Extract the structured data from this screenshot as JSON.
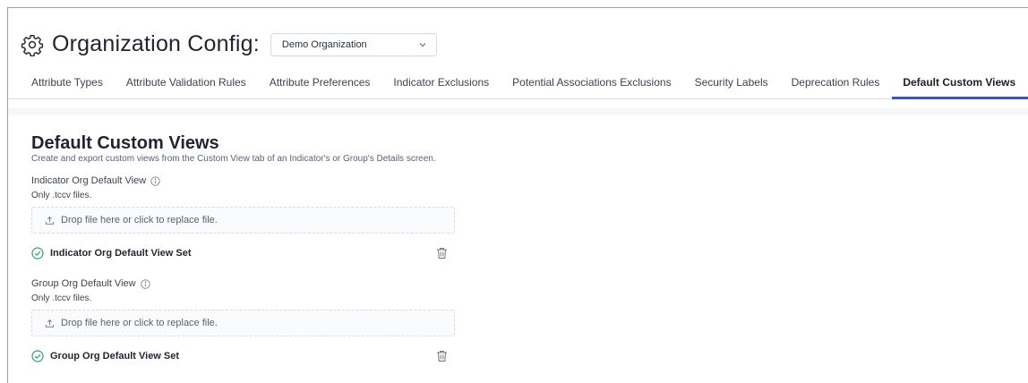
{
  "header": {
    "title": "Organization Config:",
    "org_select": {
      "value": "Demo Organization"
    }
  },
  "tabs": [
    {
      "label": "Attribute Types",
      "active": false
    },
    {
      "label": "Attribute Validation Rules",
      "active": false
    },
    {
      "label": "Attribute Preferences",
      "active": false
    },
    {
      "label": "Indicator Exclusions",
      "active": false
    },
    {
      "label": "Potential Associations Exclusions",
      "active": false
    },
    {
      "label": "Security Labels",
      "active": false
    },
    {
      "label": "Deprecation Rules",
      "active": false
    },
    {
      "label": "Default Custom Views",
      "active": true
    }
  ],
  "section": {
    "title": "Default Custom Views",
    "description": "Create and export custom views from the Custom View tab of an Indicator's or Group's Details screen."
  },
  "indicator_view": {
    "label": "Indicator Org Default View",
    "file_hint": "Only .tccv files.",
    "drop_text": "Drop file here or click to replace file.",
    "status_text": "Indicator Org Default View Set"
  },
  "group_view": {
    "label": "Group Org Default View",
    "file_hint": "Only .tccv files.",
    "drop_text": "Drop file here or click to replace file.",
    "status_text": "Group Org Default View Set"
  },
  "colors": {
    "accent": "#3457c8",
    "success": "#2fa36b",
    "trash": "#6d7583"
  }
}
